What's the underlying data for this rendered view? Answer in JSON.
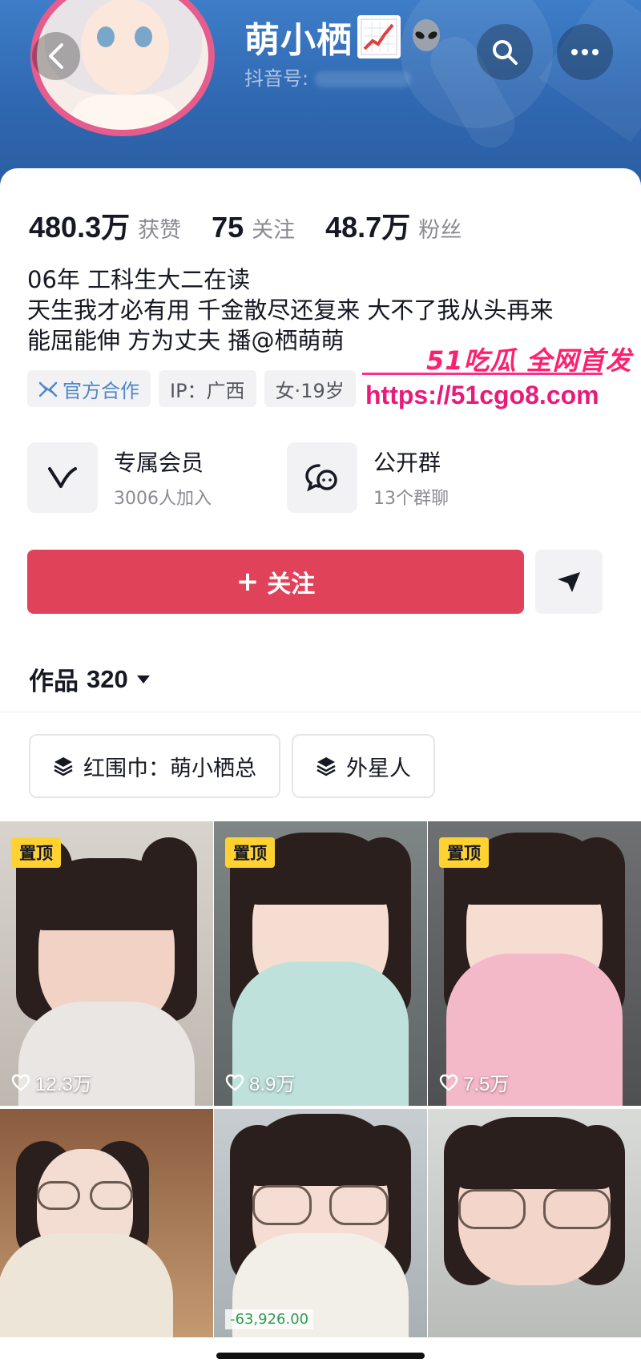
{
  "header": {
    "nickname": "萌小栖",
    "douyin_id_label": "抖音号:",
    "badge_icon": "alien-emoji"
  },
  "stats": [
    {
      "value": "480.3万",
      "label": "获赞"
    },
    {
      "value": "75",
      "label": "关注"
    },
    {
      "value": "48.7万",
      "label": "粉丝"
    }
  ],
  "bio": {
    "line1": "06年  工科生大二在读",
    "line2": "天生我才必有用 千金散尽还复来 大不了我从头再来",
    "line3_prefix": "能屈能伸 方为丈夫   播",
    "line3_mention": "@栖萌萌"
  },
  "tags": {
    "official": "官方合作",
    "ip": "IP：广西",
    "gender_age": "女·19岁"
  },
  "watermark": {
    "brand": "51吃瓜 全网首发",
    "url": "https://51cgo8.com"
  },
  "features": [
    {
      "title": "专属会员",
      "subtitle": "3006人加入",
      "icon": "v-logo-icon"
    },
    {
      "title": "公开群",
      "subtitle": "13个群聊",
      "icon": "chat-bubbles-icon"
    }
  ],
  "follow_button": {
    "label": "关注",
    "color": "#e0425a"
  },
  "works": {
    "label": "作品",
    "count": "320"
  },
  "collections": [
    {
      "label": "红围巾：萌小栖总"
    },
    {
      "label": "外星人"
    }
  ],
  "videos": [
    {
      "pinned_label": "置顶",
      "likes": "12.3万"
    },
    {
      "pinned_label": "置顶",
      "likes": "8.9万"
    },
    {
      "pinned_label": "置顶",
      "likes": "7.5万"
    },
    {
      "likes": ""
    },
    {
      "likes": "",
      "overlay": "-63,926.00"
    },
    {
      "likes": ""
    }
  ],
  "colors": {
    "header_blue": "#2f67b0",
    "accent_red": "#e0425a",
    "avatar_ring": "#e65c8c",
    "pin_yellow": "#ffd232"
  }
}
